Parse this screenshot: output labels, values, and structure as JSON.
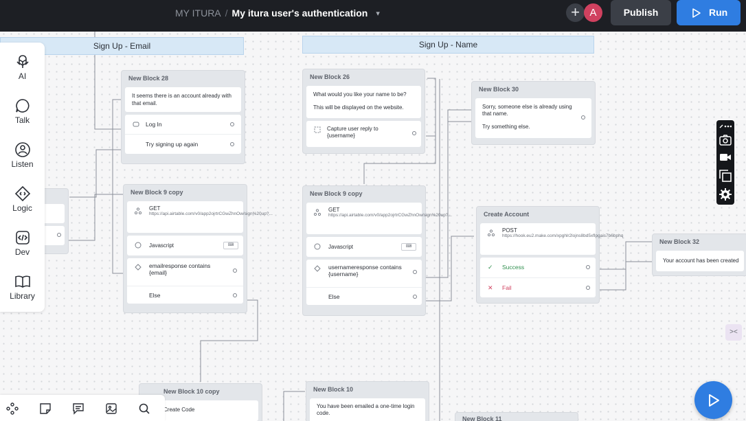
{
  "topbar": {
    "project": "MY ITURA",
    "separator": "/",
    "flow_name": "My itura user's authentication",
    "avatar_initial": "A",
    "publish_label": "Publish",
    "run_label": "Run"
  },
  "leftbar": {
    "items": [
      {
        "label": "AI",
        "icon": "ai-icon"
      },
      {
        "label": "Talk",
        "icon": "talk-icon"
      },
      {
        "label": "Listen",
        "icon": "listen-icon"
      },
      {
        "label": "Logic",
        "icon": "logic-icon"
      },
      {
        "label": "Dev",
        "icon": "dev-icon"
      },
      {
        "label": "Library",
        "icon": "library-icon"
      }
    ]
  },
  "sections": {
    "email": "Sign Up - Email",
    "name": "Sign Up - Name"
  },
  "blocks": {
    "b28": {
      "title": "New Block 28",
      "message": "It seems there is an account already with that email.",
      "choice1": "Log In",
      "choice2": "Try signing up again"
    },
    "b9copy_email": {
      "title": "New Block 9 copy",
      "method": "GET",
      "url": "https://api.airtable.com/v0/app2ojrtrCGwZhnOw/sign%20up?...",
      "js": "Javascript",
      "condition": "emailresponse contains {email}",
      "else": "Else"
    },
    "b26": {
      "title": "New Block 26",
      "line1": "What would you like your name to be?",
      "line2": "This will be displayed on the website.",
      "capture": "Capture user reply to {username}"
    },
    "b30": {
      "title": "New Block 30",
      "line1": "Sorry, someone else is already using that name.",
      "line2": "Try something else."
    },
    "b9copy_name": {
      "title": "New Block 9 copy",
      "method": "GET",
      "url": "https://api.airtable.com/v0/app2ojrtrCGwZhnOw/sign%20up?...",
      "js": "Javascript",
      "condition": "usernameresponse contains {username}",
      "else": "Else"
    },
    "create": {
      "title": "Create Account",
      "method": "POST",
      "url": "https://hook.eu2.make.com/xpghlr2lojns8bd5xflpgais7b6bphq",
      "success": "Success",
      "fail": "Fail"
    },
    "b32": {
      "title": "New Block 32",
      "message": "Your account has been created"
    },
    "b10copy": {
      "title": "New Block 10 copy",
      "row": "Create Code"
    },
    "b10": {
      "title": "New Block 10",
      "message": "You have been emailed a one-time login code."
    },
    "b11": {
      "title": "New Block 11"
    },
    "left_partial": {
      "title": ""
    }
  },
  "colors": {
    "topbar": "#1d1f24",
    "run": "#2f7de1",
    "avatar": "#d0415f",
    "section": "#d7e8f6",
    "success": "#2f8f4e",
    "fail": "#d0415f"
  }
}
